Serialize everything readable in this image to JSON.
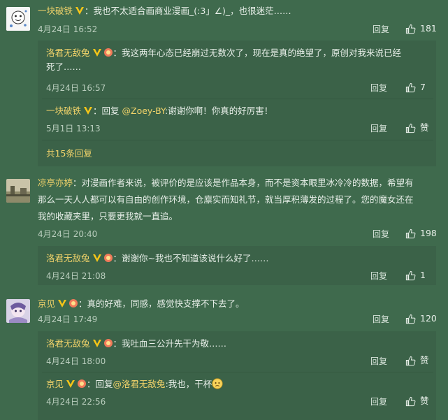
{
  "comments": [
    {
      "user": "一块破铁",
      "sep": "：",
      "text": "我也不太适合画商业漫画_(:3」∠)_，也很迷茫……",
      "time": "4月24日 16:52",
      "reply_label": "回复",
      "likes": "181",
      "replies": [
        {
          "user": "洛君无敌兔",
          "sep": "：",
          "text1": "我这两年心态已经崩过无数次了，现在是真的绝望了，原创对我来说已经",
          "text2": "死了……",
          "time": "4月24日 16:57",
          "reply_label": "回复",
          "likes": "7"
        },
        {
          "user": "一块破铁",
          "sep": "：",
          "reply_prefix": "回复 ",
          "mention": "@Zoey-BY",
          "text": ":谢谢你啊！你真的好厉害！",
          "time": "5月1日 13:13",
          "reply_label": "回复",
          "likes": "赞"
        }
      ],
      "more": "共15条回复"
    },
    {
      "user": "凉亭亦婷",
      "sep": "：",
      "text1": "对漫画作者来说，被评价的是应该是作品本身，而不是资本眼里冰冷冷的数据，希望有",
      "text2": "那么一天人人都可以有自由的创作环境，仓廪实而知礼节，就当厚积薄发的过程了。您的魔女还在",
      "text3": "我的收藏夹里，只要更我就一直追。",
      "time": "4月24日 20:40",
      "reply_label": "回复",
      "likes": "198",
      "replies": [
        {
          "user": "洛君无敌兔",
          "sep": "：",
          "text": "谢谢你~我也不知道该说什么好了……",
          "time": "4月24日 21:08",
          "reply_label": "回复",
          "likes": "1"
        }
      ]
    },
    {
      "user": "京见",
      "sep": "：",
      "text": "真的好难，同感，感觉快支撑不下去了。",
      "time": "4月24日 17:49",
      "reply_label": "回复",
      "likes": "120",
      "replies": [
        {
          "user": "洛君无敌兔",
          "sep": "：",
          "text": "我吐血三公升先干为敬……",
          "time": "4月24日 18:00",
          "reply_label": "回复",
          "likes": "赞"
        },
        {
          "user": "京见",
          "sep": "：",
          "reply_prefix": "回复",
          "mention": "@洛君无敌兔",
          "text": ":我也，干杯",
          "time": "4月24日 22:56",
          "reply_label": "回复",
          "likes": "赞"
        }
      ]
    }
  ],
  "icons": {
    "like": "thumbs-up-icon",
    "vip": "vip-v-icon",
    "badge": "fan-badge-icon",
    "emoji": "sad-face-emoji"
  },
  "colors": {
    "background": "#3f6a4d",
    "username": "#f1d36a",
    "meta": "#b9cdbd"
  }
}
